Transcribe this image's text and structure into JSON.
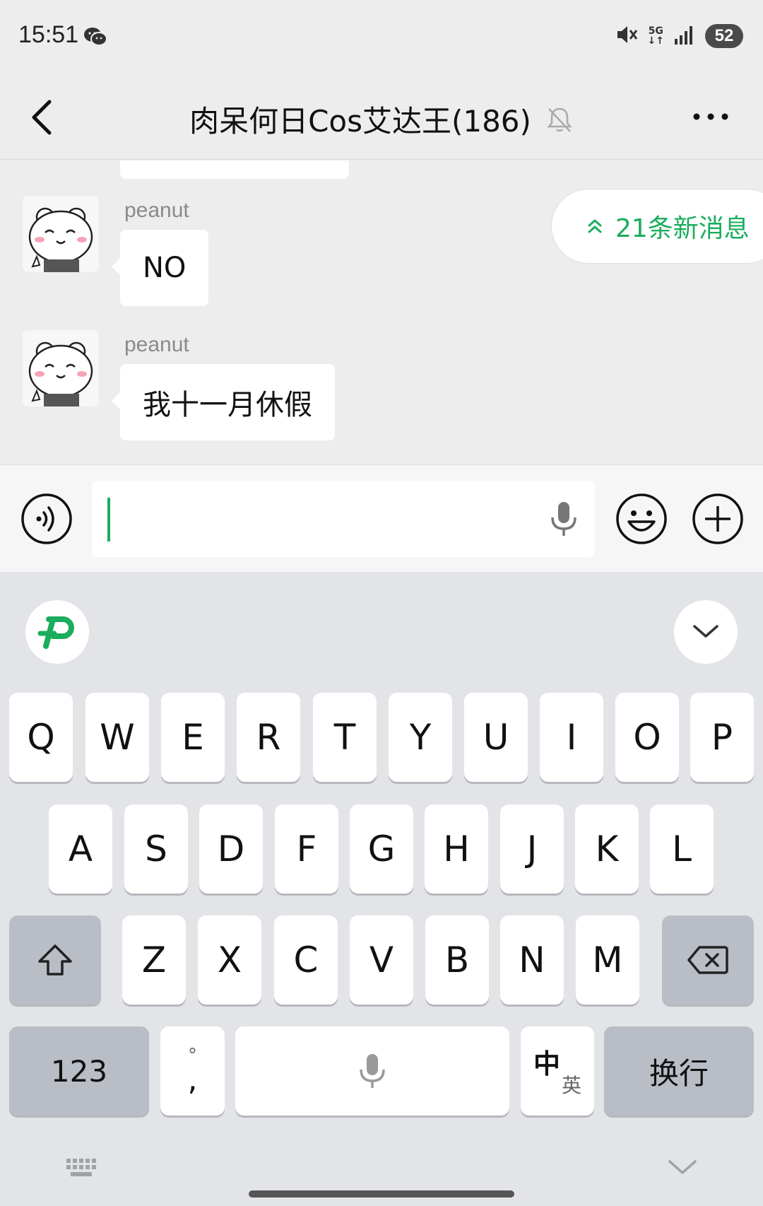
{
  "status_bar": {
    "time": "15:51",
    "net_top": "5G",
    "battery": "52"
  },
  "header": {
    "title": "肉呆何日Cos艾达王(186)"
  },
  "chat": {
    "messages": [
      {
        "sender": "peanut",
        "text": "NO"
      },
      {
        "sender": "peanut",
        "text": "我十一月休假"
      }
    ],
    "new_messages_label": "21条新消息"
  },
  "input": {
    "value": ""
  },
  "keyboard": {
    "row1": [
      "Q",
      "W",
      "E",
      "R",
      "T",
      "Y",
      "U",
      "I",
      "O",
      "P"
    ],
    "row2": [
      "A",
      "S",
      "D",
      "F",
      "G",
      "H",
      "J",
      "K",
      "L"
    ],
    "row3": [
      "Z",
      "X",
      "C",
      "V",
      "B",
      "N",
      "M"
    ],
    "numbers_key": "123",
    "punct_top": "°",
    "punct_bottom": ",",
    "lang_zh": "中",
    "lang_en": "英",
    "enter_key": "换行"
  },
  "colors": {
    "accent": "#1aad5d",
    "background": "#ededed",
    "keyboard": "#e3e4e8"
  }
}
